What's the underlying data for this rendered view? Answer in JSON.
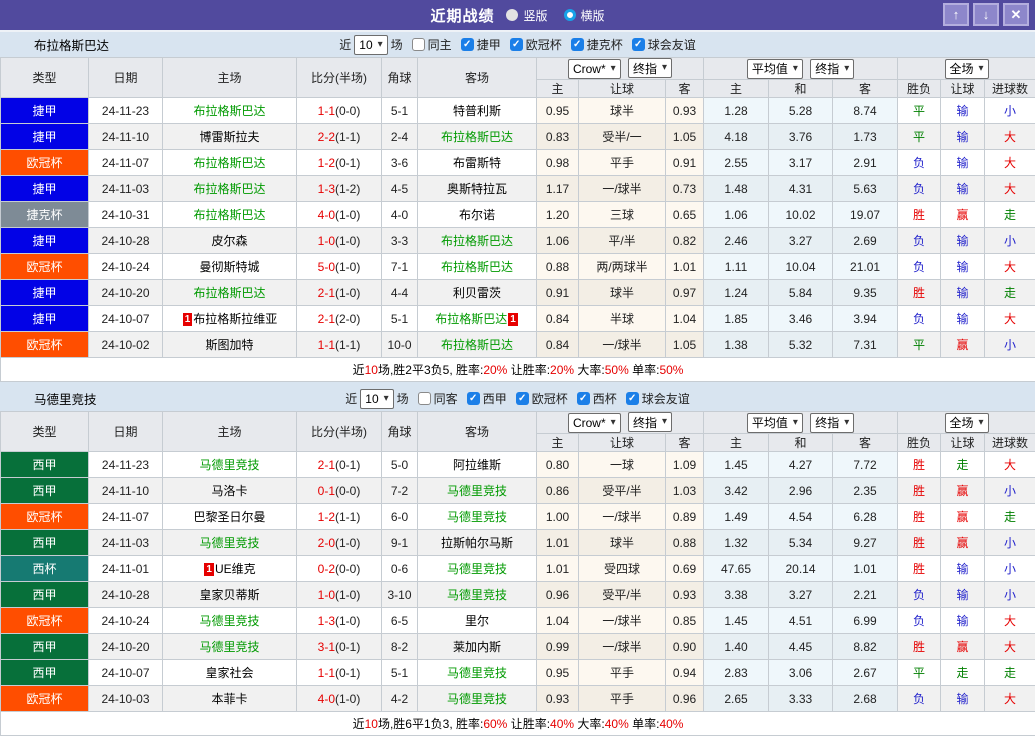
{
  "icons": {
    "check": "✓",
    "up": "↑",
    "down": "↓",
    "close": "✕",
    "chevron": "▾"
  },
  "header": {
    "title": "近期战绩",
    "radio_vertical": "竖版",
    "radio_horizontal": "横版"
  },
  "ui": {
    "near": "近",
    "games": "场"
  },
  "columns": {
    "type": "类型",
    "date": "日期",
    "home": "主场",
    "score": "比分(半场)",
    "corner": "角球",
    "away": "客场",
    "sub": [
      "主",
      "让球",
      "客",
      "主",
      "和",
      "客",
      "胜负",
      "让球",
      "进球数"
    ]
  },
  "dropdowns": {
    "crow": "Crow*",
    "final": "终指",
    "avg": "平均值",
    "full": "全场"
  },
  "league_colors": {
    "捷甲": "#0202e6",
    "欧冠杯": "#ff4e00",
    "捷克杯": "#7e8b96",
    "西甲": "#07703a",
    "西杯": "#167a72"
  },
  "sections": [
    {
      "team": "布拉格斯巴达",
      "filter": {
        "count": "10",
        "same_label": "同主",
        "leagues": [
          "捷甲",
          "欧冠杯",
          "捷克杯",
          "球会友谊"
        ]
      },
      "rows": [
        {
          "lg": "捷甲",
          "date": "24-11-23",
          "h": "布拉格斯巴达",
          "hs": true,
          "hc": false,
          "sc": "1-1",
          "hf": "(0-0)",
          "cn": "5-1",
          "a": "特普利斯",
          "as": false,
          "ac": false,
          "od": [
            "0.95",
            "球半",
            "0.93"
          ],
          "av": [
            "1.28",
            "5.28",
            "8.74"
          ],
          "rs": [
            [
              "平",
              "g"
            ],
            [
              "输",
              "b"
            ],
            [
              "小",
              "b"
            ]
          ]
        },
        {
          "lg": "捷甲",
          "date": "24-11-10",
          "h": "博雷斯拉夫",
          "hs": false,
          "hc": false,
          "sc": "2-2",
          "hf": "(1-1)",
          "cn": "2-4",
          "a": "布拉格斯巴达",
          "as": true,
          "ac": false,
          "od": [
            "0.83",
            "受半/一",
            "1.05"
          ],
          "av": [
            "4.18",
            "3.76",
            "1.73"
          ],
          "rs": [
            [
              "平",
              "g"
            ],
            [
              "输",
              "b"
            ],
            [
              "大",
              "r"
            ]
          ]
        },
        {
          "lg": "欧冠杯",
          "date": "24-11-07",
          "h": "布拉格斯巴达",
          "hs": true,
          "hc": false,
          "sc": "1-2",
          "hf": "(0-1)",
          "cn": "3-6",
          "a": "布雷斯特",
          "as": false,
          "ac": false,
          "od": [
            "0.98",
            "平手",
            "0.91"
          ],
          "av": [
            "2.55",
            "3.17",
            "2.91"
          ],
          "rs": [
            [
              "负",
              "b"
            ],
            [
              "输",
              "b"
            ],
            [
              "大",
              "r"
            ]
          ]
        },
        {
          "lg": "捷甲",
          "date": "24-11-03",
          "h": "布拉格斯巴达",
          "hs": true,
          "hc": false,
          "sc": "1-3",
          "hf": "(1-2)",
          "cn": "4-5",
          "a": "奥斯特拉瓦",
          "as": false,
          "ac": false,
          "od": [
            "1.17",
            "一/球半",
            "0.73"
          ],
          "av": [
            "1.48",
            "4.31",
            "5.63"
          ],
          "rs": [
            [
              "负",
              "b"
            ],
            [
              "输",
              "b"
            ],
            [
              "大",
              "r"
            ]
          ]
        },
        {
          "lg": "捷克杯",
          "date": "24-10-31",
          "h": "布拉格斯巴达",
          "hs": true,
          "hc": false,
          "sc": "4-0",
          "hf": "(1-0)",
          "cn": "4-0",
          "a": "布尔诺",
          "as": false,
          "ac": false,
          "od": [
            "1.20",
            "三球",
            "0.65"
          ],
          "av": [
            "1.06",
            "10.02",
            "19.07"
          ],
          "rs": [
            [
              "胜",
              "r"
            ],
            [
              "赢",
              "r"
            ],
            [
              "走",
              "g"
            ]
          ]
        },
        {
          "lg": "捷甲",
          "date": "24-10-28",
          "h": "皮尔森",
          "hs": false,
          "hc": false,
          "sc": "1-0",
          "hf": "(1-0)",
          "cn": "3-3",
          "a": "布拉格斯巴达",
          "as": true,
          "ac": false,
          "od": [
            "1.06",
            "平/半",
            "0.82"
          ],
          "av": [
            "2.46",
            "3.27",
            "2.69"
          ],
          "rs": [
            [
              "负",
              "b"
            ],
            [
              "输",
              "b"
            ],
            [
              "小",
              "b"
            ]
          ]
        },
        {
          "lg": "欧冠杯",
          "date": "24-10-24",
          "h": "曼彻斯特城",
          "hs": false,
          "hc": false,
          "sc": "5-0",
          "hf": "(1-0)",
          "cn": "7-1",
          "a": "布拉格斯巴达",
          "as": true,
          "ac": false,
          "od": [
            "0.88",
            "两/两球半",
            "1.01"
          ],
          "av": [
            "1.11",
            "10.04",
            "21.01"
          ],
          "rs": [
            [
              "负",
              "b"
            ],
            [
              "输",
              "b"
            ],
            [
              "大",
              "r"
            ]
          ]
        },
        {
          "lg": "捷甲",
          "date": "24-10-20",
          "h": "布拉格斯巴达",
          "hs": true,
          "hc": false,
          "sc": "2-1",
          "hf": "(1-0)",
          "cn": "4-4",
          "a": "利贝雷茨",
          "as": false,
          "ac": false,
          "od": [
            "0.91",
            "球半",
            "0.97"
          ],
          "av": [
            "1.24",
            "5.84",
            "9.35"
          ],
          "rs": [
            [
              "胜",
              "r"
            ],
            [
              "输",
              "b"
            ],
            [
              "走",
              "g"
            ]
          ]
        },
        {
          "lg": "捷甲",
          "date": "24-10-07",
          "h": "布拉格斯拉维亚",
          "hs": false,
          "hc": true,
          "sc": "2-1",
          "hf": "(2-0)",
          "cn": "5-1",
          "a": "布拉格斯巴达",
          "as": true,
          "ac": true,
          "od": [
            "0.84",
            "半球",
            "1.04"
          ],
          "av": [
            "1.85",
            "3.46",
            "3.94"
          ],
          "rs": [
            [
              "负",
              "b"
            ],
            [
              "输",
              "b"
            ],
            [
              "大",
              "r"
            ]
          ]
        },
        {
          "lg": "欧冠杯",
          "date": "24-10-02",
          "h": "斯图加特",
          "hs": false,
          "hc": false,
          "sc": "1-1",
          "hf": "(1-1)",
          "cn": "10-0",
          "a": "布拉格斯巴达",
          "as": true,
          "ac": false,
          "od": [
            "0.84",
            "一/球半",
            "1.05"
          ],
          "av": [
            "1.38",
            "5.32",
            "7.31"
          ],
          "rs": [
            [
              "平",
              "g"
            ],
            [
              "赢",
              "r"
            ],
            [
              "小",
              "b"
            ]
          ]
        }
      ],
      "footer": [
        [
          "近",
          "k"
        ],
        [
          "10",
          "r"
        ],
        [
          "场,胜2平3负5, 胜率:",
          "k"
        ],
        [
          "20%",
          "r"
        ],
        [
          " 让胜率:",
          "k"
        ],
        [
          "20%",
          "r"
        ],
        [
          " 大率:",
          "k"
        ],
        [
          "50%",
          "r"
        ],
        [
          " 单率:",
          "k"
        ],
        [
          "50%",
          "r"
        ]
      ]
    },
    {
      "team": "马德里竞技",
      "filter": {
        "count": "10",
        "same_label": "同客",
        "leagues": [
          "西甲",
          "欧冠杯",
          "西杯",
          "球会友谊"
        ]
      },
      "rows": [
        {
          "lg": "西甲",
          "date": "24-11-23",
          "h": "马德里竞技",
          "hs": true,
          "hc": false,
          "sc": "2-1",
          "hf": "(0-1)",
          "cn": "5-0",
          "a": "阿拉维斯",
          "as": false,
          "ac": false,
          "od": [
            "0.80",
            "一球",
            "1.09"
          ],
          "av": [
            "1.45",
            "4.27",
            "7.72"
          ],
          "rs": [
            [
              "胜",
              "r"
            ],
            [
              "走",
              "g"
            ],
            [
              "大",
              "r"
            ]
          ]
        },
        {
          "lg": "西甲",
          "date": "24-11-10",
          "h": "马洛卡",
          "hs": false,
          "hc": false,
          "sc": "0-1",
          "hf": "(0-0)",
          "cn": "7-2",
          "a": "马德里竞技",
          "as": true,
          "ac": false,
          "od": [
            "0.86",
            "受平/半",
            "1.03"
          ],
          "av": [
            "3.42",
            "2.96",
            "2.35"
          ],
          "rs": [
            [
              "胜",
              "r"
            ],
            [
              "赢",
              "r"
            ],
            [
              "小",
              "b"
            ]
          ]
        },
        {
          "lg": "欧冠杯",
          "date": "24-11-07",
          "h": "巴黎圣日尔曼",
          "hs": false,
          "hc": false,
          "sc": "1-2",
          "hf": "(1-1)",
          "cn": "6-0",
          "a": "马德里竞技",
          "as": true,
          "ac": false,
          "od": [
            "1.00",
            "一/球半",
            "0.89"
          ],
          "av": [
            "1.49",
            "4.54",
            "6.28"
          ],
          "rs": [
            [
              "胜",
              "r"
            ],
            [
              "赢",
              "r"
            ],
            [
              "走",
              "g"
            ]
          ]
        },
        {
          "lg": "西甲",
          "date": "24-11-03",
          "h": "马德里竞技",
          "hs": true,
          "hc": false,
          "sc": "2-0",
          "hf": "(1-0)",
          "cn": "9-1",
          "a": "拉斯帕尔马斯",
          "as": false,
          "ac": false,
          "od": [
            "1.01",
            "球半",
            "0.88"
          ],
          "av": [
            "1.32",
            "5.34",
            "9.27"
          ],
          "rs": [
            [
              "胜",
              "r"
            ],
            [
              "赢",
              "r"
            ],
            [
              "小",
              "b"
            ]
          ]
        },
        {
          "lg": "西杯",
          "date": "24-11-01",
          "h": "UE维克",
          "hs": false,
          "hc": true,
          "sc": "0-2",
          "hf": "(0-0)",
          "cn": "0-6",
          "a": "马德里竞技",
          "as": true,
          "ac": false,
          "od": [
            "1.01",
            "受四球",
            "0.69"
          ],
          "av": [
            "47.65",
            "20.14",
            "1.01"
          ],
          "rs": [
            [
              "胜",
              "r"
            ],
            [
              "输",
              "b"
            ],
            [
              "小",
              "b"
            ]
          ]
        },
        {
          "lg": "西甲",
          "date": "24-10-28",
          "h": "皇家贝蒂斯",
          "hs": false,
          "hc": false,
          "sc": "1-0",
          "hf": "(1-0)",
          "cn": "3-10",
          "a": "马德里竞技",
          "as": true,
          "ac": false,
          "od": [
            "0.96",
            "受平/半",
            "0.93"
          ],
          "av": [
            "3.38",
            "3.27",
            "2.21"
          ],
          "rs": [
            [
              "负",
              "b"
            ],
            [
              "输",
              "b"
            ],
            [
              "小",
              "b"
            ]
          ]
        },
        {
          "lg": "欧冠杯",
          "date": "24-10-24",
          "h": "马德里竞技",
          "hs": true,
          "hc": false,
          "sc": "1-3",
          "hf": "(1-0)",
          "cn": "6-5",
          "a": "里尔",
          "as": false,
          "ac": false,
          "od": [
            "1.04",
            "一/球半",
            "0.85"
          ],
          "av": [
            "1.45",
            "4.51",
            "6.99"
          ],
          "rs": [
            [
              "负",
              "b"
            ],
            [
              "输",
              "b"
            ],
            [
              "大",
              "r"
            ]
          ]
        },
        {
          "lg": "西甲",
          "date": "24-10-20",
          "h": "马德里竞技",
          "hs": true,
          "hc": false,
          "sc": "3-1",
          "hf": "(0-1)",
          "cn": "8-2",
          "a": "莱加内斯",
          "as": false,
          "ac": false,
          "od": [
            "0.99",
            "一/球半",
            "0.90"
          ],
          "av": [
            "1.40",
            "4.45",
            "8.82"
          ],
          "rs": [
            [
              "胜",
              "r"
            ],
            [
              "赢",
              "r"
            ],
            [
              "大",
              "r"
            ]
          ]
        },
        {
          "lg": "西甲",
          "date": "24-10-07",
          "h": "皇家社会",
          "hs": false,
          "hc": false,
          "sc": "1-1",
          "hf": "(0-1)",
          "cn": "5-1",
          "a": "马德里竞技",
          "as": true,
          "ac": false,
          "od": [
            "0.95",
            "平手",
            "0.94"
          ],
          "av": [
            "2.83",
            "3.06",
            "2.67"
          ],
          "rs": [
            [
              "平",
              "g"
            ],
            [
              "走",
              "g"
            ],
            [
              "走",
              "g"
            ]
          ]
        },
        {
          "lg": "欧冠杯",
          "date": "24-10-03",
          "h": "本菲卡",
          "hs": false,
          "hc": false,
          "sc": "4-0",
          "hf": "(1-0)",
          "cn": "4-2",
          "a": "马德里竞技",
          "as": true,
          "ac": false,
          "od": [
            "0.93",
            "平手",
            "0.96"
          ],
          "av": [
            "2.65",
            "3.33",
            "2.68"
          ],
          "rs": [
            [
              "负",
              "b"
            ],
            [
              "输",
              "b"
            ],
            [
              "大",
              "r"
            ]
          ]
        }
      ],
      "footer": [
        [
          "近",
          "k"
        ],
        [
          "10",
          "r"
        ],
        [
          "场,胜6平1负3, 胜率:",
          "k"
        ],
        [
          "60%",
          "r"
        ],
        [
          " 让胜率:",
          "k"
        ],
        [
          "40%",
          "r"
        ],
        [
          " 大率:",
          "k"
        ],
        [
          "40%",
          "r"
        ],
        [
          " 单率:",
          "k"
        ],
        [
          "40%",
          "r"
        ]
      ]
    }
  ]
}
